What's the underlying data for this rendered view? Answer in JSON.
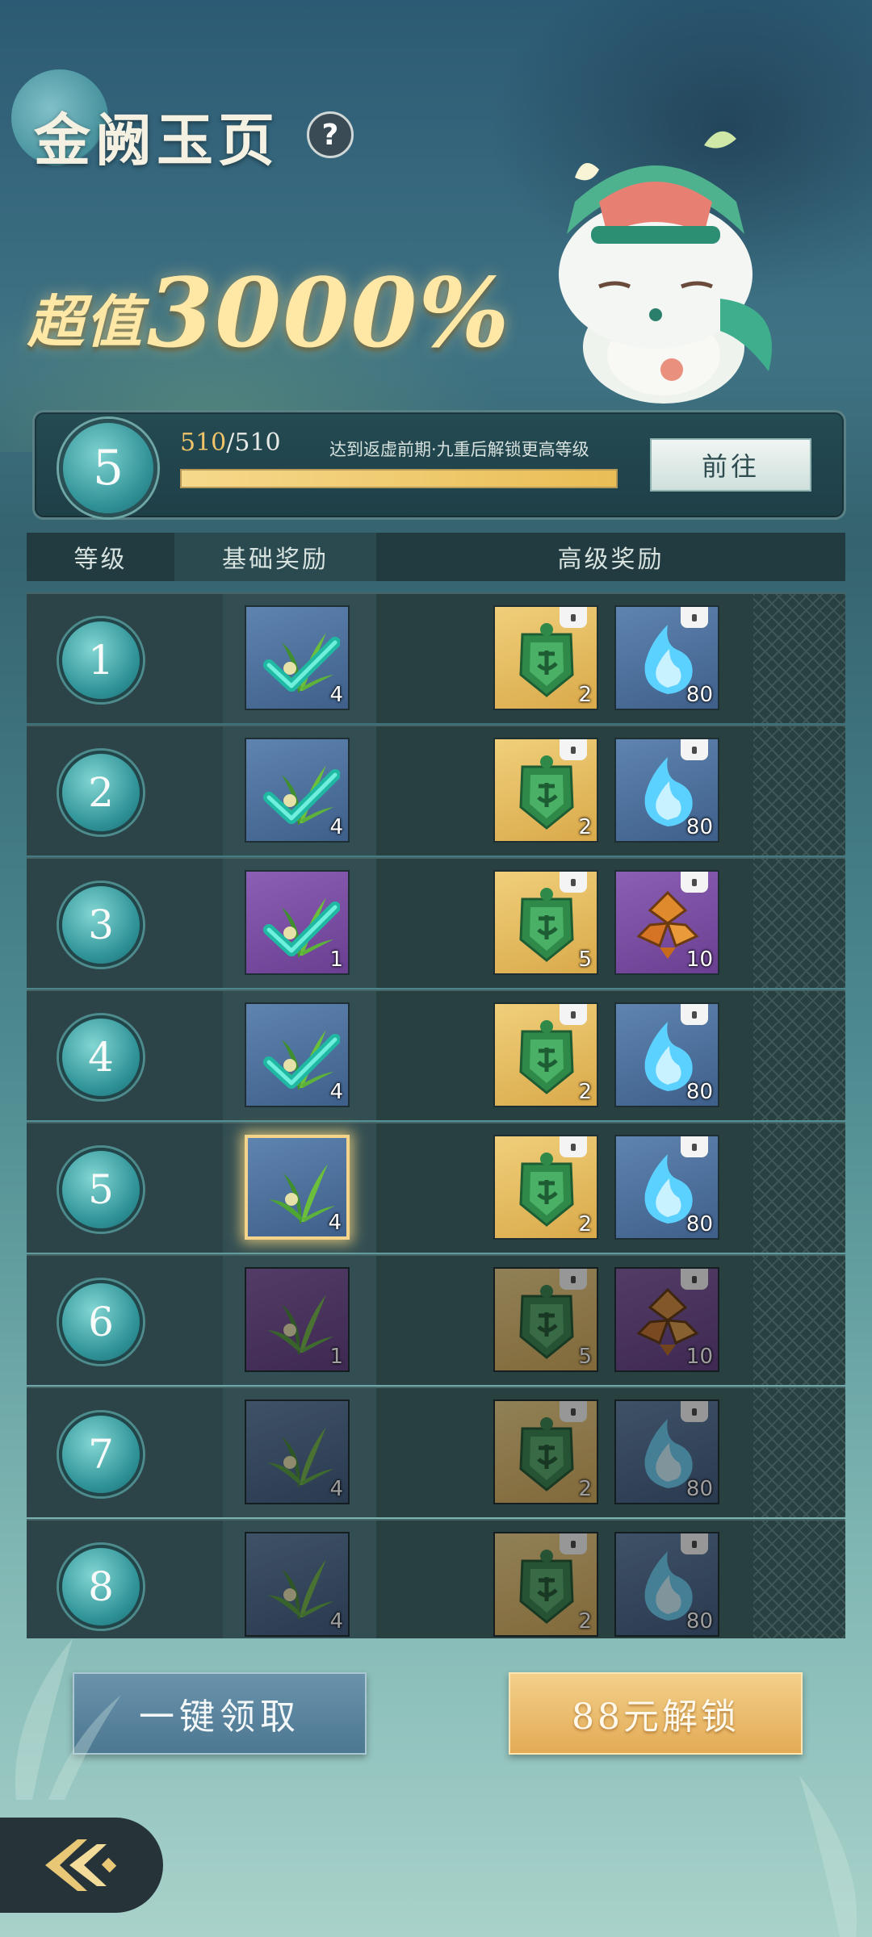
{
  "header": {
    "title": "金阙玉页",
    "help_icon": "?",
    "promo_prefix": "超值",
    "promo_value": "3000%"
  },
  "progress": {
    "level": "5",
    "current": "510",
    "separator": "/",
    "max": "510",
    "fill_fraction": 1.0,
    "hint": "达到返虚前期·九重后解锁更高等级",
    "goto_label": "前往"
  },
  "table": {
    "col_level": "等级",
    "col_basic": "基础奖励",
    "col_advanced": "高级奖励"
  },
  "rows": [
    {
      "level": "1",
      "basic": {
        "icon": "herb-icon",
        "rarity": "blue",
        "count": "4",
        "claimed": true
      },
      "adv": [
        {
          "icon": "jade-token-icon",
          "count": "2"
        },
        {
          "icon": "blue-flame-icon",
          "rarity": "blue",
          "count": "80"
        }
      ]
    },
    {
      "level": "2",
      "basic": {
        "icon": "herb-icon",
        "rarity": "blue",
        "count": "4",
        "claimed": true
      },
      "adv": [
        {
          "icon": "jade-token-icon",
          "count": "2"
        },
        {
          "icon": "blue-flame-icon",
          "rarity": "blue",
          "count": "80"
        }
      ]
    },
    {
      "level": "3",
      "basic": {
        "icon": "herb-icon",
        "rarity": "purple",
        "count": "1",
        "claimed": true
      },
      "adv": [
        {
          "icon": "jade-token-icon",
          "count": "5"
        },
        {
          "icon": "amber-fragment-icon",
          "rarity": "purple",
          "count": "10"
        }
      ]
    },
    {
      "level": "4",
      "basic": {
        "icon": "herb-icon",
        "rarity": "blue",
        "count": "4",
        "claimed": true
      },
      "adv": [
        {
          "icon": "jade-token-icon",
          "count": "2"
        },
        {
          "icon": "blue-flame-icon",
          "rarity": "blue",
          "count": "80"
        }
      ]
    },
    {
      "level": "5",
      "basic": {
        "icon": "herb-icon",
        "rarity": "blue",
        "count": "4",
        "claimed": false,
        "current": true
      },
      "adv": [
        {
          "icon": "jade-token-icon",
          "count": "2"
        },
        {
          "icon": "blue-flame-icon",
          "rarity": "blue",
          "count": "80"
        }
      ]
    },
    {
      "level": "6",
      "basic": {
        "icon": "herb-icon",
        "rarity": "purple",
        "count": "1",
        "claimed": false,
        "locked": true
      },
      "adv": [
        {
          "icon": "jade-token-icon",
          "count": "5"
        },
        {
          "icon": "amber-fragment-icon",
          "rarity": "purple",
          "count": "10"
        }
      ]
    },
    {
      "level": "7",
      "basic": {
        "icon": "herb-icon",
        "rarity": "blue",
        "count": "4",
        "claimed": false,
        "locked": true
      },
      "adv": [
        {
          "icon": "jade-token-icon",
          "count": "2"
        },
        {
          "icon": "blue-flame-icon",
          "rarity": "blue",
          "count": "80"
        }
      ]
    },
    {
      "level": "8",
      "basic": {
        "icon": "herb-icon",
        "rarity": "blue",
        "count": "4",
        "claimed": false,
        "locked": true
      },
      "adv": [
        {
          "icon": "jade-token-icon",
          "count": "2"
        },
        {
          "icon": "blue-flame-icon",
          "rarity": "blue",
          "count": "80"
        }
      ]
    }
  ],
  "buttons": {
    "claim_all": "一键领取",
    "unlock": "88元解锁"
  },
  "colors": {
    "accent_gold": "#f2c46a",
    "teal_badge": "#2e9297",
    "check_green": "#2ec9b4"
  }
}
